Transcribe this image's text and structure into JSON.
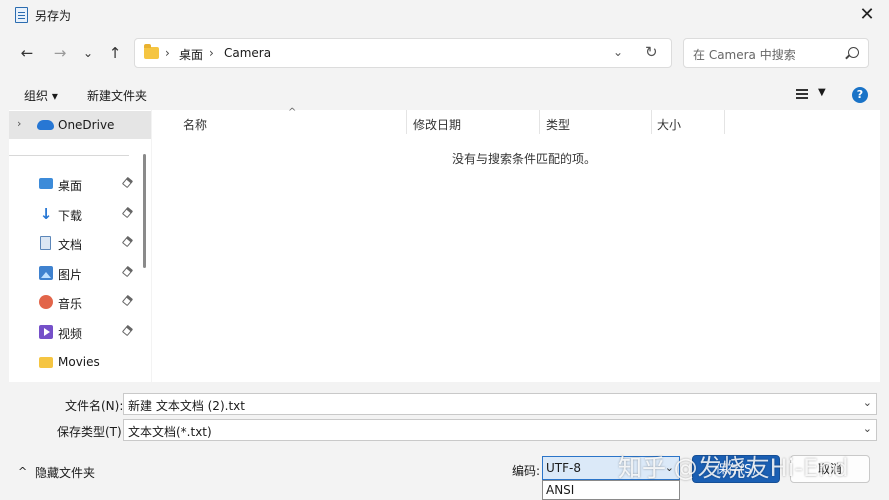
{
  "window": {
    "title": "另存为",
    "close_label": "✕"
  },
  "nav": {
    "back": "←",
    "forward": "→",
    "recent": "⌄",
    "up": "↑",
    "breadcrumb": [
      "桌面",
      "Camera"
    ],
    "separator": "›",
    "address_dropdown": "⌄",
    "refresh": "↻",
    "search_placeholder": "在 Camera 中搜索"
  },
  "toolbar": {
    "organize": "组织 ▾",
    "new_folder": "新建文件夹",
    "view_dropdown": "▼",
    "help": "?"
  },
  "sidebar": {
    "quick_access": {
      "label": "OneDrive",
      "chevron": "›"
    },
    "items": [
      {
        "label": "桌面",
        "icon": "desktop-icon"
      },
      {
        "label": "下载",
        "icon": "download-icon"
      },
      {
        "label": "文档",
        "icon": "document-icon"
      },
      {
        "label": "图片",
        "icon": "picture-icon"
      },
      {
        "label": "音乐",
        "icon": "music-icon"
      },
      {
        "label": "视频",
        "icon": "video-icon"
      },
      {
        "label": "Movies",
        "icon": "folder-icon"
      }
    ]
  },
  "files": {
    "columns": [
      "名称",
      "修改日期",
      "类型",
      "大小"
    ],
    "sort_indicator": "^",
    "empty_message": "没有与搜索条件匹配的项。"
  },
  "form": {
    "filename_label": "文件名(N):",
    "filename_value": "新建 文本文档 (2).txt",
    "filetype_label": "保存类型(T):",
    "filetype_value": "文本文档(*.txt)",
    "dropdown": "⌄"
  },
  "footer": {
    "hide_folders": "隐藏文件夹",
    "hide_chevron": "^",
    "encoding_label": "编码:",
    "encoding_value": "UTF-8",
    "encoding_dropdown": "⌄",
    "encoding_options": [
      "ANSI"
    ],
    "save_button": "保存(S)",
    "cancel_button": "取消"
  },
  "watermark": "知乎 @发烧友Hi-End",
  "colors": {
    "accent": "#1a5fb4",
    "selection": "#dbe9f8",
    "pane_bg": "#ffffff",
    "chrome_bg": "#f3f3f3"
  }
}
